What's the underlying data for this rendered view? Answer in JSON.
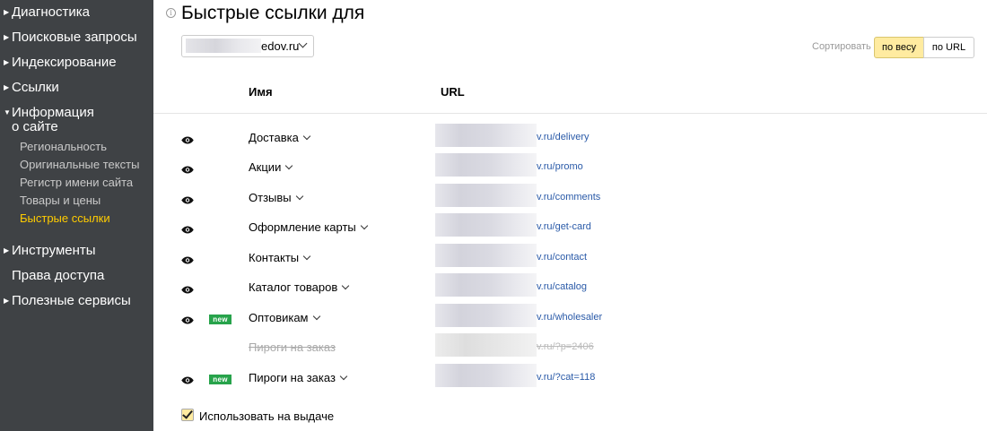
{
  "sidebar": {
    "main_items": [
      {
        "label": "Диагностика"
      },
      {
        "label": "Поисковые запросы"
      },
      {
        "label": "Индексирование"
      },
      {
        "label": "Ссылки"
      },
      {
        "label_line1": "Информация",
        "label_line2": "о сайте"
      },
      {
        "label": "Инструменты"
      },
      {
        "label": "Права доступа"
      },
      {
        "label": "Полезные сервисы"
      }
    ],
    "sub_items": [
      {
        "label": "Региональность"
      },
      {
        "label": "Оригинальные тексты"
      },
      {
        "label": "Регистр имени сайта"
      },
      {
        "label": "Товары и цены"
      },
      {
        "label": "Быстрые ссылки",
        "active": true
      }
    ]
  },
  "header": {
    "title": "Быстрые ссылки для",
    "site_selector_value": "edov.ru"
  },
  "sort": {
    "label": "Сортировать",
    "options": [
      "по весу",
      "по URL"
    ],
    "selected": "по весу"
  },
  "table": {
    "columns": {
      "name": "Имя",
      "url": "URL"
    },
    "rows": [
      {
        "name": "Доставка",
        "url": "v.ru/delivery",
        "visible": true,
        "new": false,
        "disabled": false
      },
      {
        "name": "Акции",
        "url": "v.ru/promo",
        "visible": true,
        "new": false,
        "disabled": false
      },
      {
        "name": "Отзывы",
        "url": "v.ru/comments",
        "visible": true,
        "new": false,
        "disabled": false
      },
      {
        "name": "Оформление карты",
        "url": "v.ru/get-card",
        "visible": true,
        "new": false,
        "disabled": false
      },
      {
        "name": "Контакты",
        "url": "v.ru/contact",
        "visible": true,
        "new": false,
        "disabled": false
      },
      {
        "name": "Каталог товаров",
        "url": "v.ru/catalog",
        "visible": true,
        "new": false,
        "disabled": false
      },
      {
        "name": "Оптовикам",
        "url": "v.ru/wholesaler",
        "visible": true,
        "new": true,
        "disabled": false
      },
      {
        "name": "Пироги на заказ",
        "url": "v.ru/?p=2406",
        "visible": false,
        "new": false,
        "disabled": true
      },
      {
        "name": "Пироги на заказ",
        "url": "v.ru/?cat=118",
        "visible": true,
        "new": true,
        "disabled": false
      }
    ],
    "new_badge_label": "new"
  },
  "footer": {
    "use_in_results_label": "Использовать на выдаче",
    "use_in_results_checked": true
  },
  "colors": {
    "sidebar_bg": "#3f4245",
    "active_nav": "#ffcc00",
    "link": "#2a5aa8",
    "new_badge": "#27a34b",
    "sort_selected_bg": "#ffeba0"
  },
  "icons": {
    "row_visibility": "eye-icon",
    "row_dropdown": "chevron-down-icon",
    "nav_expand": "triangle-right-icon",
    "nav_collapse": "triangle-down-icon",
    "title_info": "info-icon"
  }
}
